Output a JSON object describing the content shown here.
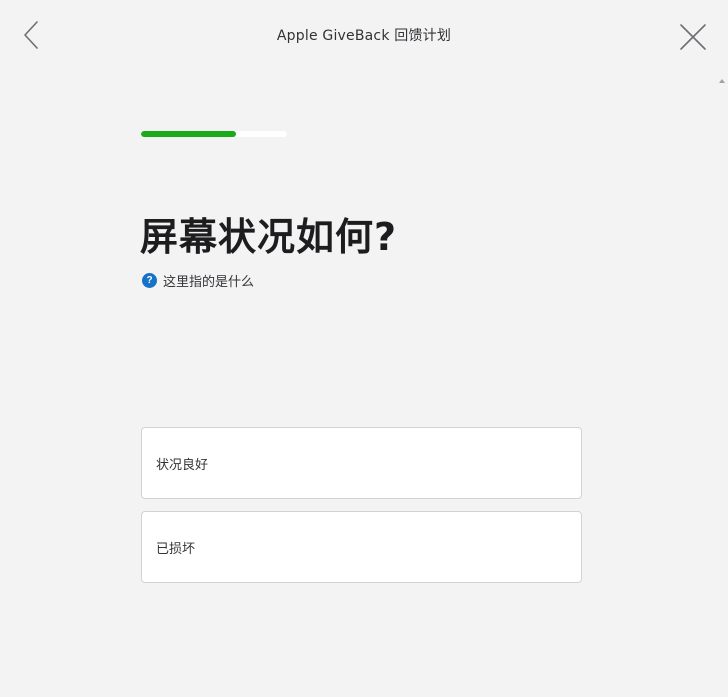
{
  "header": {
    "title": "Apple GiveBack 回馈计划",
    "back_icon": "chevron-left-icon",
    "close_icon": "close-icon"
  },
  "progress": {
    "fraction": 0.65,
    "fill_color": "#1aaa1a",
    "track_color": "#ffffff"
  },
  "question": {
    "title": "屏幕状况如何?",
    "help_icon": "question-circle-icon",
    "help_icon_glyph": "?",
    "help_text": "这里指的是什么",
    "help_icon_color": "#1672c6"
  },
  "options": [
    {
      "label": "状况良好"
    },
    {
      "label": "已损坏"
    }
  ]
}
